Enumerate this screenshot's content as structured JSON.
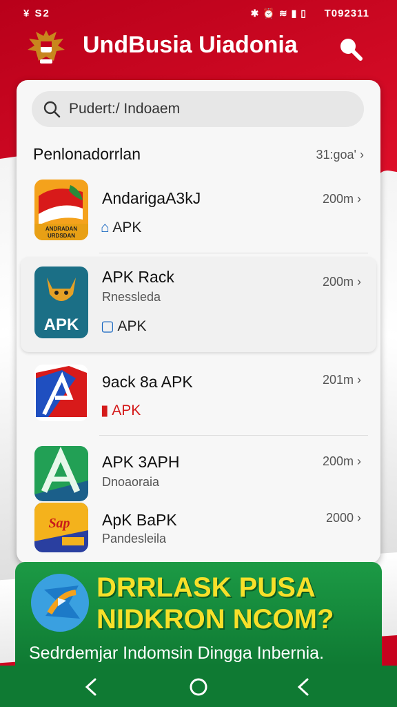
{
  "status": {
    "left": "¥ S2",
    "right": "T092311"
  },
  "appbar": {
    "title": "UndBusia Uiadonia"
  },
  "search": {
    "placeholder": "Pudert:/ Indoaem"
  },
  "section": {
    "title": "Penlonadorrlan",
    "more": "31:goa'"
  },
  "items": [
    {
      "name": "AndarigaA3kJ",
      "tag": "APK",
      "size": "200m"
    },
    {
      "name": "APK Rack",
      "subtitle": "Rnessleda",
      "tag": "APK",
      "size": "200m",
      "icon_text": "APK"
    },
    {
      "name": "9ack 8a APK",
      "tag": "APK",
      "size": "201m"
    },
    {
      "name": "APK 3APH",
      "subtitle": "Dnoaoraia",
      "size": "200m"
    },
    {
      "name": "ApK BaPK",
      "subtitle": "Pandesleila",
      "size": "2000"
    }
  ],
  "banner": {
    "headline_line1": "DRRLASK PUSA",
    "headline_line2": "NIDKRON NCOM?",
    "tagline": "Sedrdemjar Indomsin Dingga Inbernia."
  },
  "colors": {
    "brand_red": "#d8001c",
    "banner_green": "#138a3c",
    "headline_yellow": "#f7e02a",
    "tag_blue": "#1565c0",
    "tag_red": "#d41a1a"
  }
}
